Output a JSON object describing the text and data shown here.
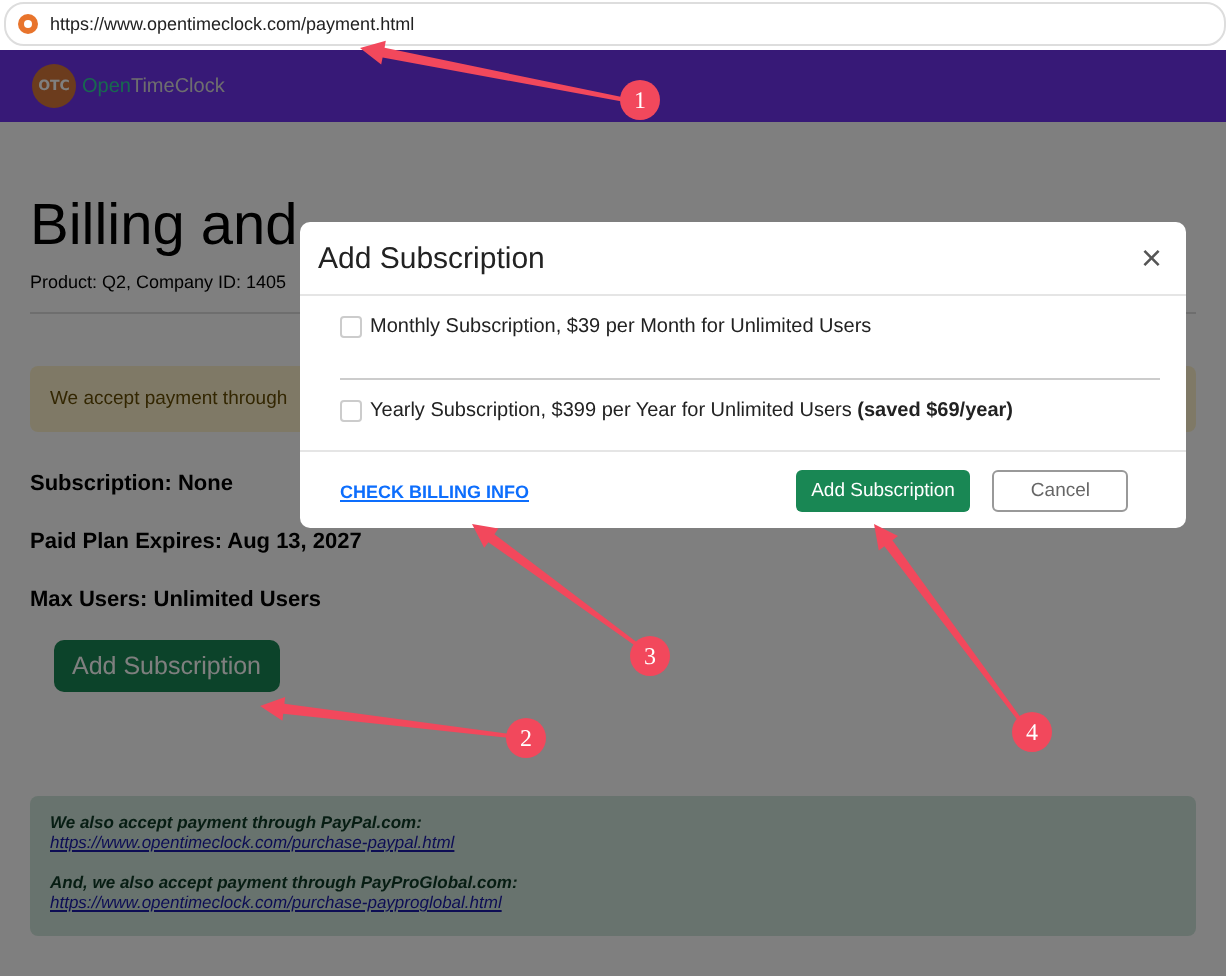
{
  "browser": {
    "url": "https://www.opentimeclock.com/payment.html"
  },
  "header": {
    "logo_badge": "OTC",
    "brand_first": "Open",
    "brand_second": "TimeClock"
  },
  "page": {
    "title": "Billing and",
    "product_line": "Product: Q2, Company ID: 1405",
    "notice": "We accept payment through",
    "details": [
      "Subscription: None",
      "Paid Plan Expires: Aug 13, 2027",
      "Max Users: Unlimited Users"
    ],
    "add_button": "Add Subscription",
    "payment_info": [
      {
        "text": "We also accept payment through PayPal.com:",
        "link": "https://www.opentimeclock.com/purchase-paypal.html"
      },
      {
        "text": "And, we also accept payment through PayProGlobal.com:",
        "link": "https://www.opentimeclock.com/purchase-payproglobal.html"
      }
    ]
  },
  "modal": {
    "title": "Add Subscription",
    "close": "×",
    "options": [
      {
        "label": "Monthly Subscription, $39 per Month for Unlimited Users",
        "checked": false
      },
      {
        "label": "Yearly Subscription, $399 per Year for Unlimited Users **(saved $69/year)**",
        "checked": false
      }
    ],
    "link": "CHECK BILLING INFO",
    "primary": "Add Subscription",
    "cancel": "Cancel"
  },
  "annotations": [
    {
      "number": "1"
    },
    {
      "number": "2"
    },
    {
      "number": "3"
    },
    {
      "number": "4"
    }
  ]
}
